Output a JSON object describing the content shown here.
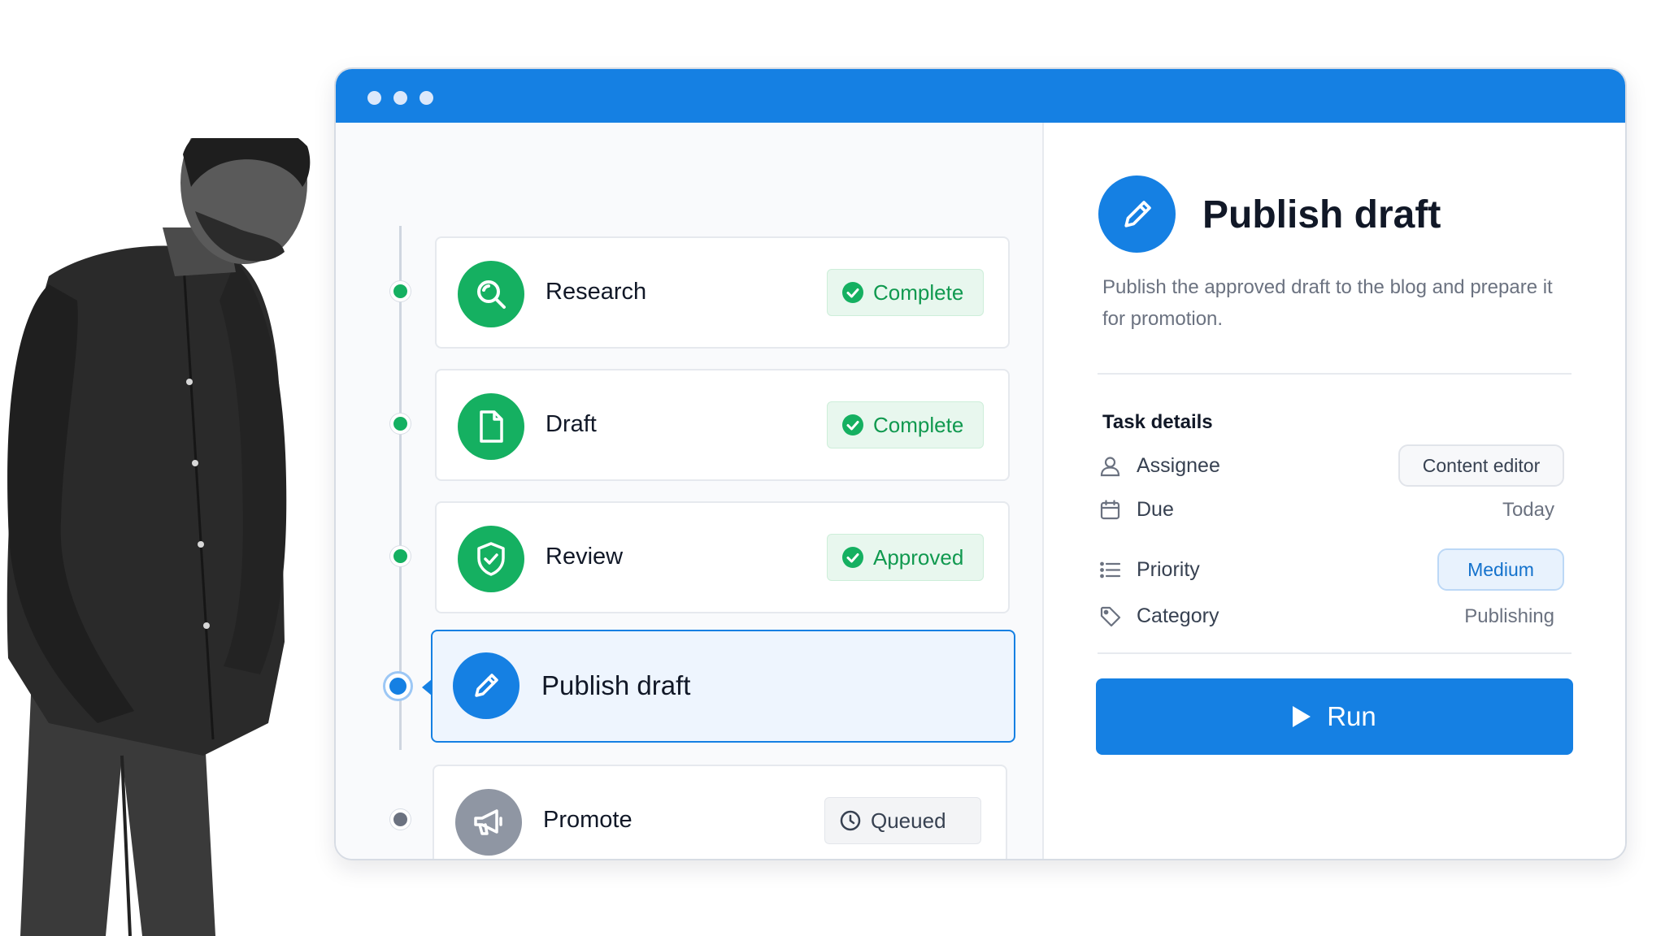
{
  "colors": {
    "accent": "#1580e3",
    "success": "#15b061",
    "success_text": "#10994f",
    "queued": "#8f96a3"
  },
  "workflow": {
    "steps": [
      {
        "label": "Research",
        "icon": "search-icon",
        "status": "Complete",
        "status_icon": "check-circle-icon"
      },
      {
        "label": "Draft",
        "icon": "document-icon",
        "status": "Complete",
        "status_icon": "check-circle-icon"
      },
      {
        "label": "Review",
        "icon": "shield-check-icon",
        "status": "Approved",
        "status_icon": "check-circle-icon"
      },
      {
        "label": "Publish draft",
        "icon": "pencil-icon",
        "status": "",
        "active": true
      },
      {
        "label": "Promote",
        "icon": "megaphone-icon",
        "status": "Queued",
        "status_icon": "clock-icon"
      }
    ]
  },
  "details": {
    "title": "Publish draft",
    "icon": "pencil-icon",
    "description": "Publish the approved draft to the blog and prepare it for promotion.",
    "section_title": "Task details",
    "rows": {
      "assignee": {
        "label": "Assignee",
        "value": "Content editor",
        "icon": "user-icon"
      },
      "due": {
        "label": "Due",
        "value": "Today",
        "icon": "calendar-icon"
      },
      "priority": {
        "label": "Priority",
        "value": "Medium",
        "icon": "list-icon"
      },
      "category": {
        "label": "Category",
        "value": "Publishing",
        "icon": "tag-icon"
      }
    },
    "run_label": "Run"
  }
}
